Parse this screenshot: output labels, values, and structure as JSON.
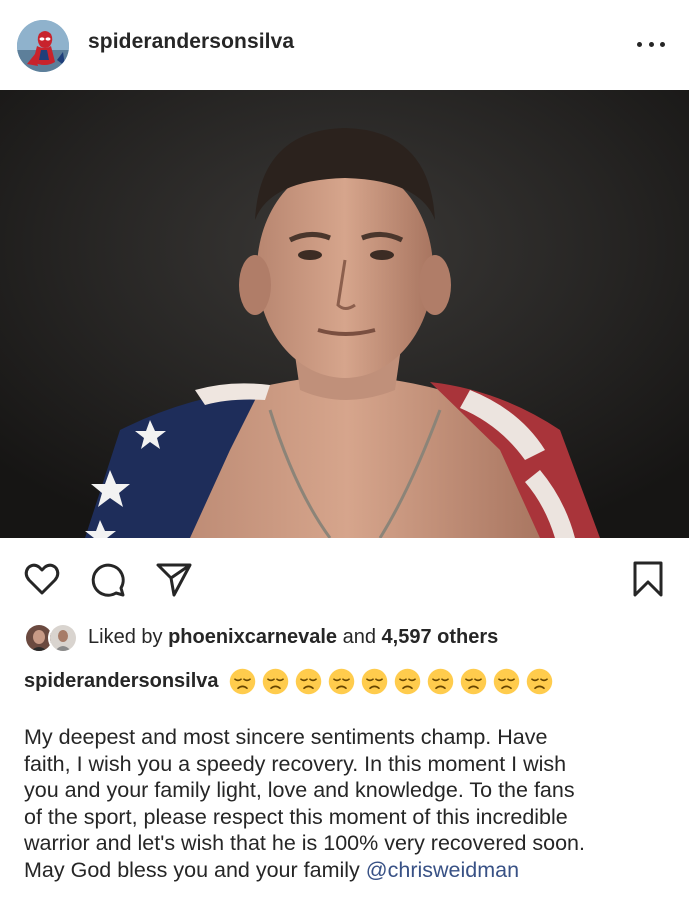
{
  "post": {
    "username": "spiderandersonsilva",
    "avatar_icon": "spiderman-avatar",
    "more_icon": "more-horizontal-icon",
    "photo_alt": "photo"
  },
  "actions": {
    "like_icon": "heart-icon",
    "comment_icon": "comment-icon",
    "share_icon": "send-icon",
    "save_icon": "bookmark-icon"
  },
  "likes": {
    "prefix": "Liked by",
    "liker": "phoenixcarnevale",
    "joiner": "and",
    "others": "4,597 others"
  },
  "caption": {
    "username": "spiderandersonsilva",
    "emoji_count": 10,
    "emoji_icon": "disappointed-face-emoji",
    "lines": [
      "My deepest and most sincere sentiments champ. Have",
      "faith, I wish you a speedy recovery. In this moment I wish",
      "you and your family light, love and knowledge. To the fans",
      "of the sport, please respect this moment of this incredible",
      "warrior and let's wish that he is 100% very recovered  soon."
    ],
    "last_line": "May God bless you and your family",
    "mention": "@chrisweidman"
  },
  "colors": {
    "text": "#262626",
    "mention": "#385185",
    "photo_bg": "#1f1e1d",
    "emoji": "#ffcc4d"
  }
}
